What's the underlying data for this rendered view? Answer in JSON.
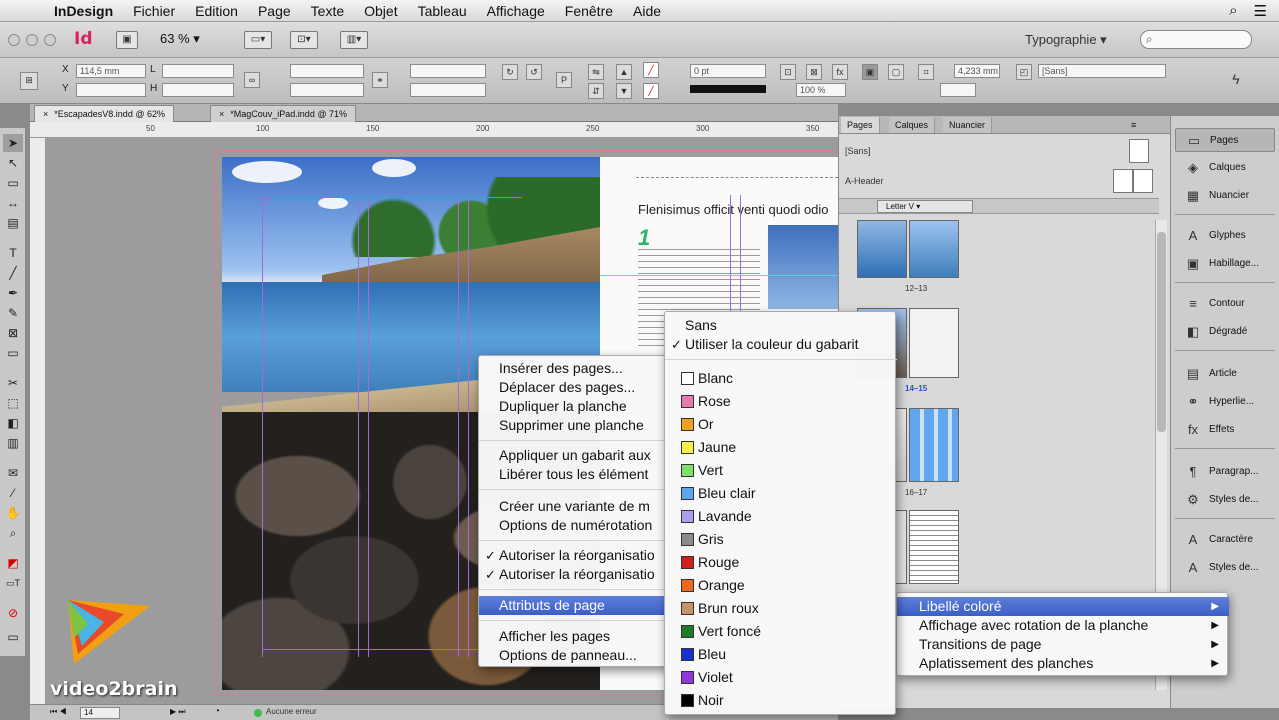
{
  "menubar": {
    "app": "InDesign",
    "items": [
      "Fichier",
      "Edition",
      "Page",
      "Texte",
      "Objet",
      "Tableau",
      "Affichage",
      "Fenêtre",
      "Aide"
    ]
  },
  "appbar": {
    "logo": "Id",
    "zoom": "63 %",
    "workspace": "Typographie",
    "search_placeholder": ""
  },
  "control": {
    "x_field": "114,5 mm",
    "y_field": "",
    "stroke_weight": "0 pt",
    "percent_field": "100 %",
    "dimension_field": "4,233 mm",
    "style_field": "[Sans]"
  },
  "tabs": [
    {
      "label": "*EscapadesV8.indd @ 62%",
      "active": true
    },
    {
      "label": "*MagCouv_iPad.indd @ 71%",
      "active": false
    }
  ],
  "ruler": {
    "numbers": [
      "50",
      "100",
      "150",
      "200",
      "250",
      "300",
      "350"
    ]
  },
  "document": {
    "headline": "Flenisimus officit venti quodi odio",
    "number": "1"
  },
  "pages_panel": {
    "tabs": [
      "Pages",
      "Calques",
      "Nuancier"
    ],
    "masters": [
      {
        "label": "[Sans]"
      },
      {
        "label": "A-Header"
      }
    ],
    "size_dropdown": "Letter V",
    "spreads": [
      {
        "label": "12–13"
      },
      {
        "label": "14–15"
      },
      {
        "label": "16–17"
      },
      {
        "label": ""
      }
    ]
  },
  "dock": {
    "items": [
      {
        "label": "Pages",
        "icon": "pages-icon",
        "glyph": "▭"
      },
      {
        "label": "Calques",
        "icon": "layers-icon",
        "glyph": "◈"
      },
      {
        "label": "Nuancier",
        "icon": "swatches-icon",
        "glyph": "▦"
      },
      {
        "label": "Glyphes",
        "icon": "glyphs-icon",
        "glyph": "A"
      },
      {
        "label": "Habillage...",
        "icon": "text-wrap-icon",
        "glyph": "▣"
      },
      {
        "label": "Contour",
        "icon": "stroke-icon",
        "glyph": "≡"
      },
      {
        "label": "Dégradé",
        "icon": "gradient-icon",
        "glyph": "◧"
      },
      {
        "label": "Article",
        "icon": "article-icon",
        "glyph": "▤"
      },
      {
        "label": "Hyperlie...",
        "icon": "hyperlinks-icon",
        "glyph": "⚭"
      },
      {
        "label": "Effets",
        "icon": "effects-icon",
        "glyph": "fx"
      },
      {
        "label": "Paragrap...",
        "icon": "paragraph-styles-icon",
        "glyph": "¶"
      },
      {
        "label": "Styles de...",
        "icon": "object-styles-icon",
        "glyph": "⚙"
      },
      {
        "label": "Caractère",
        "icon": "character-icon",
        "glyph": "A"
      },
      {
        "label": "Styles de...",
        "icon": "character-styles-icon",
        "glyph": "A"
      }
    ]
  },
  "context_menu": {
    "items": [
      {
        "label": "Insérer des pages...",
        "checked": false
      },
      {
        "label": "Déplacer des pages...",
        "checked": false
      },
      {
        "label": "Dupliquer la planche",
        "checked": false
      },
      {
        "label": "Supprimer une planche",
        "checked": false
      },
      {
        "label": "Appliquer un gabarit aux",
        "checked": false
      },
      {
        "label": "Libérer tous les élément",
        "checked": false
      },
      {
        "label": "Créer une variante de m",
        "checked": false
      },
      {
        "label": "Options de numérotation",
        "checked": false
      },
      {
        "label": "Autoriser la réorganisatio",
        "checked": true
      },
      {
        "label": "Autoriser la réorganisatio",
        "checked": true
      },
      {
        "label": "Attributs de page",
        "checked": false
      },
      {
        "label": "Afficher les pages",
        "checked": false
      },
      {
        "label": "Options de panneau...",
        "checked": false
      }
    ]
  },
  "submenu_page_attributes": {
    "items": [
      {
        "label": "Libellé coloré",
        "highlighted": true
      },
      {
        "label": "Affichage avec rotation de la planche",
        "highlighted": false
      },
      {
        "label": "Transitions de page",
        "highlighted": false
      },
      {
        "label": "Aplatissement des planches",
        "highlighted": false
      }
    ]
  },
  "color_menu": {
    "top_items": [
      {
        "label": "Sans",
        "checked": false
      },
      {
        "label": "Utiliser la couleur du gabarit",
        "checked": true
      }
    ],
    "colors": [
      {
        "label": "Blanc",
        "color": "#ffffff"
      },
      {
        "label": "Rose",
        "color": "#e87ab0"
      },
      {
        "label": "Or",
        "color": "#f0a020"
      },
      {
        "label": "Jaune",
        "color": "#f6ee4a"
      },
      {
        "label": "Vert",
        "color": "#7ee06a"
      },
      {
        "label": "Bleu clair",
        "color": "#5ea6ee"
      },
      {
        "label": "Lavande",
        "color": "#a8a0ea"
      },
      {
        "label": "Gris",
        "color": "#8a8a8a"
      },
      {
        "label": "Rouge",
        "color": "#d21e1e"
      },
      {
        "label": "Orange",
        "color": "#e86a1a"
      },
      {
        "label": "Brun roux",
        "color": "#c49468"
      },
      {
        "label": "Vert foncé",
        "color": "#1f7a2a"
      },
      {
        "label": "Bleu",
        "color": "#1a2ed6"
      },
      {
        "label": "Violet",
        "color": "#8a3ad6"
      },
      {
        "label": "Noir",
        "color": "#000000"
      }
    ]
  },
  "statusbar": {
    "page_field": "14",
    "status": "Aucune erreur"
  },
  "watermark": {
    "text": "video2brain"
  }
}
